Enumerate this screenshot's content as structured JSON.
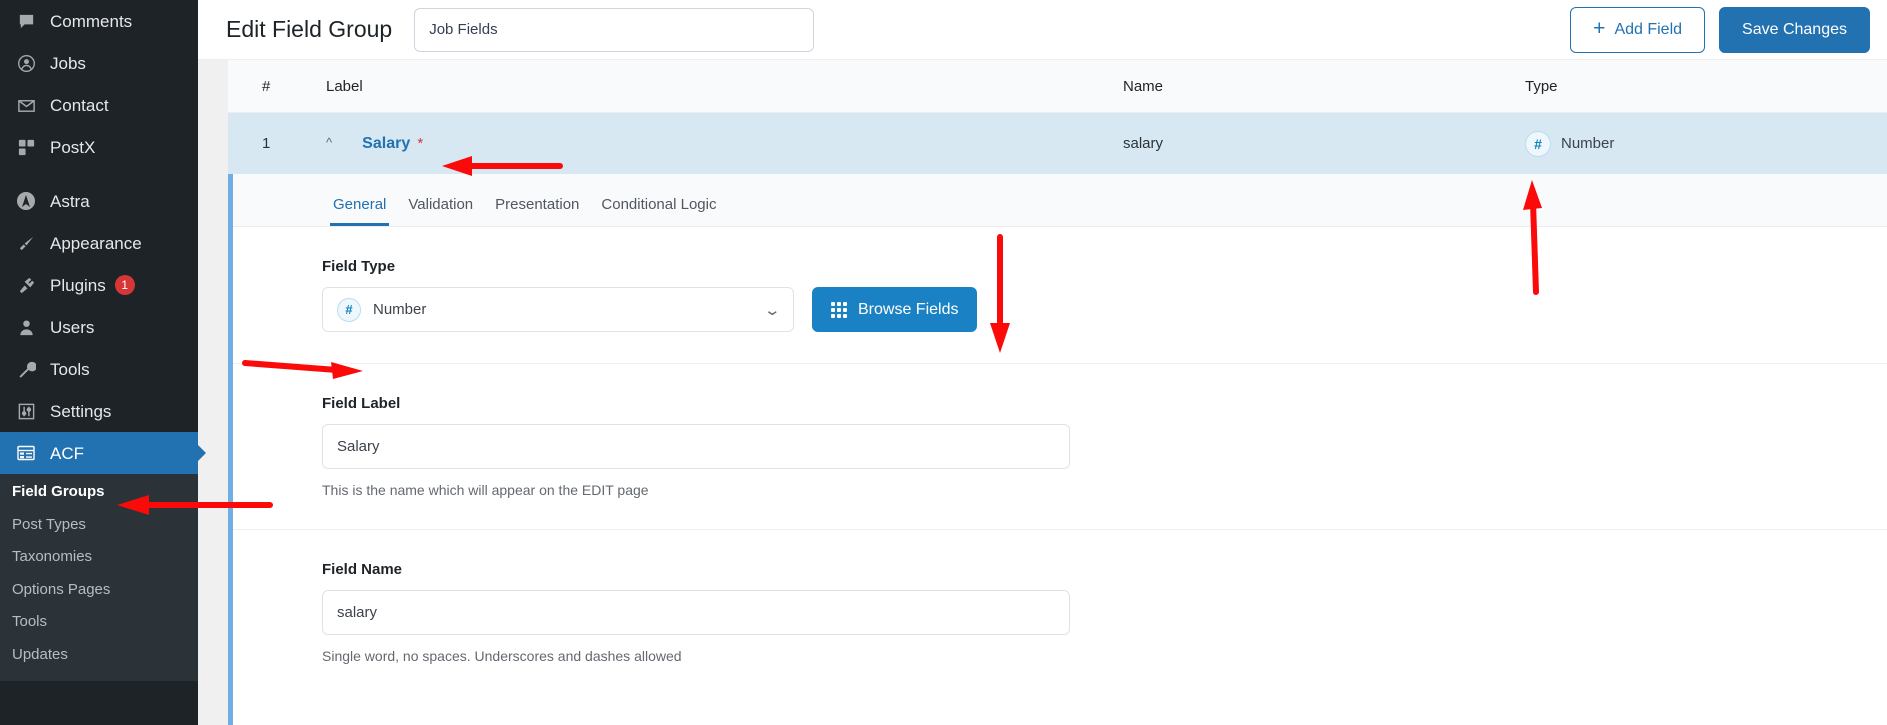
{
  "sidebar": {
    "items": [
      {
        "label": "Comments",
        "icon": "comment-icon"
      },
      {
        "label": "Jobs",
        "icon": "jobs-icon"
      },
      {
        "label": "Contact",
        "icon": "mail-icon"
      },
      {
        "label": "PostX",
        "icon": "postx-icon"
      },
      {
        "label": "Astra",
        "icon": "astra-icon",
        "gap": true
      },
      {
        "label": "Appearance",
        "icon": "paintbrush-icon"
      },
      {
        "label": "Plugins",
        "icon": "plug-icon",
        "badge": "1"
      },
      {
        "label": "Users",
        "icon": "user-icon"
      },
      {
        "label": "Tools",
        "icon": "wrench-icon"
      },
      {
        "label": "Settings",
        "icon": "sliders-icon"
      },
      {
        "label": "ACF",
        "icon": "acf-icon",
        "active": true
      }
    ],
    "submenu": [
      {
        "label": "Field Groups",
        "current": true
      },
      {
        "label": "Post Types"
      },
      {
        "label": "Taxonomies"
      },
      {
        "label": "Options Pages"
      },
      {
        "label": "Tools"
      },
      {
        "label": "Updates"
      }
    ]
  },
  "header": {
    "title": "Edit Field Group",
    "title_input_value": "Job Fields",
    "title_input_placeholder": "Add title",
    "add_field_label": "Add Field",
    "add_field_icon": "plus-icon",
    "save_label": "Save Changes"
  },
  "table": {
    "columns": {
      "number": "#",
      "label": "Label",
      "name": "Name",
      "type": "Type"
    },
    "rows": [
      {
        "number": "1",
        "label": "Salary",
        "required_marker": "*",
        "name": "salary",
        "type": "Number",
        "type_icon_glyph": "#",
        "toggle_icon": "chevron-up-icon"
      }
    ]
  },
  "field_panel": {
    "tabs": [
      {
        "label": "General",
        "active": true
      },
      {
        "label": "Validation",
        "active": false
      },
      {
        "label": "Presentation",
        "active": false
      },
      {
        "label": "Conditional Logic",
        "active": false
      }
    ],
    "field_type": {
      "label": "Field Type",
      "value": "Number",
      "icon_glyph": "#",
      "chevron": "chevron-down-icon",
      "browse_button_label": "Browse Fields",
      "browse_button_icon": "grid-icon"
    },
    "field_label": {
      "label": "Field Label",
      "value": "Salary",
      "placeholder": "",
      "helper": "This is the name which will appear on the EDIT page"
    },
    "field_name": {
      "label": "Field Name",
      "value": "salary",
      "placeholder": "",
      "helper": "Single word, no spaces. Underscores and dashes allowed"
    }
  },
  "colors": {
    "accent": "#2271b1",
    "sidebar_bg": "#1d2327",
    "submenu_bg": "#2c3338",
    "row_highlight": "#d7e8f3",
    "panel_border": "#72aee6",
    "annotation": "#fb0a0a",
    "required_star": "#d63638"
  },
  "annotations": [
    {
      "name": "arrow-to-field-groups",
      "direction": "left"
    },
    {
      "name": "arrow-to-salary-label",
      "direction": "left"
    },
    {
      "name": "arrow-to-field-type-select",
      "direction": "right"
    },
    {
      "name": "arrow-to-browse-fields",
      "direction": "down"
    },
    {
      "name": "arrow-to-type-column",
      "direction": "up"
    }
  ]
}
